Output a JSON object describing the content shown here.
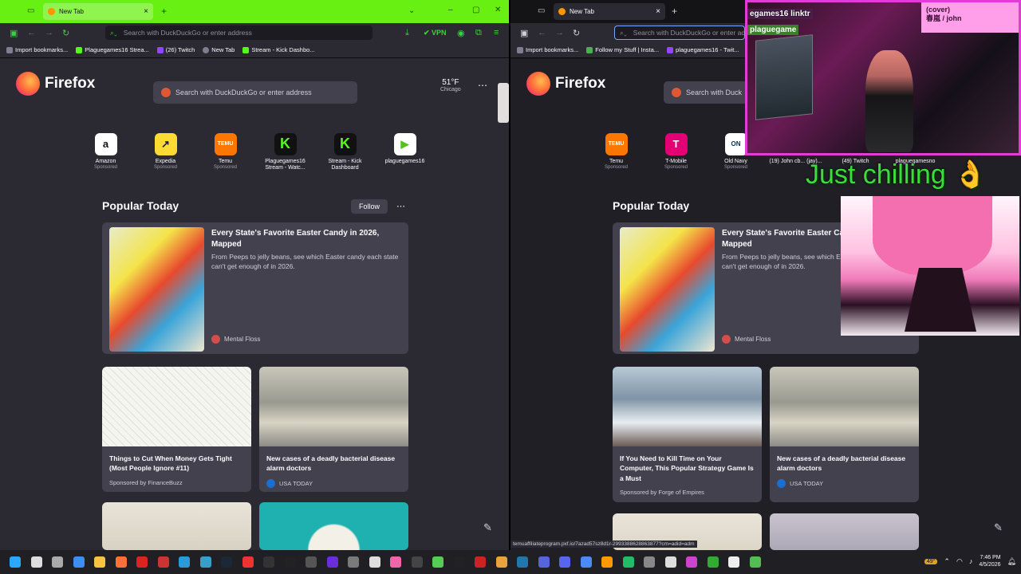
{
  "left_window": {
    "tab_title": "New Tab",
    "url_placeholder": "Search with DuckDuckGo or enter address",
    "vpn_label": "VPN",
    "bookmarks": [
      "Import bookmarks...",
      "Plaguegames16 Strea...",
      "(26) Twitch",
      "New Tab",
      "Stream - Kick Dashbo..."
    ],
    "brand": "Firefox",
    "search_placeholder": "Search with DuckDuckGo or enter address",
    "weather": {
      "temp": "51°F",
      "city": "Chicago"
    },
    "tiles": [
      {
        "name": "Amazon",
        "sub": "Sponsored",
        "icon": "amazon-icon",
        "glyph": "a"
      },
      {
        "name": "Expedia",
        "sub": "Sponsored",
        "icon": "expedia-icon",
        "glyph": "↗"
      },
      {
        "name": "Temu",
        "sub": "Sponsored",
        "icon": "temu-icon",
        "glyph": "TEMU"
      },
      {
        "name": "Plaguegames16 Stream - Watc...",
        "sub": "",
        "icon": "kick-icon",
        "glyph": "K"
      },
      {
        "name": "Stream - Kick Dashboard",
        "sub": "",
        "icon": "kick-icon",
        "glyph": "K"
      },
      {
        "name": "plaguegames16",
        "sub": "",
        "icon": "play-icon",
        "glyph": "▶"
      }
    ],
    "section_title": "Popular Today",
    "follow_label": "Follow",
    "featured": {
      "title": "Every State's Favorite Easter Candy in 2026, Mapped",
      "desc": "From Peeps to jelly beans, see which Easter candy each state can't get enough of in 2026.",
      "source": "Mental Floss"
    },
    "cards": [
      {
        "title": "Things to Cut When Money Gets Tight (Most People Ignore #11)",
        "source": "Sponsored by FinanceBuzz"
      },
      {
        "title": "New cases of a deadly bacterial disease alarm doctors",
        "source": "USA TODAY"
      }
    ]
  },
  "right_window": {
    "tab_title": "New Tab",
    "url_placeholder": "Search with DuckDuckGo or enter address",
    "bookmarks": [
      "Import bookmarks...",
      "Follow my Stuff | Insta...",
      "plaguegames16 - Twit..."
    ],
    "brand": "Firefox",
    "search_placeholder": "Search with Duck",
    "tiles": [
      {
        "name": "Temu",
        "sub": "Sponsored",
        "icon": "temu-icon",
        "glyph": "TEMU"
      },
      {
        "name": "T-Mobile",
        "sub": "Sponsored",
        "icon": "tmobile-icon",
        "glyph": "T"
      },
      {
        "name": "Old Navy",
        "sub": "Sponsored",
        "icon": "oldnavy-icon",
        "glyph": "ON"
      },
      {
        "name": "(19) John cb... (jay)...",
        "sub": "",
        "icon": "site-icon",
        "glyph": ""
      },
      {
        "name": "(49) Twitch",
        "sub": "",
        "icon": "twitch-icon",
        "glyph": ""
      },
      {
        "name": "plaguegamesno",
        "sub": "",
        "icon": "site-icon",
        "glyph": ""
      }
    ],
    "section_title": "Popular Today",
    "featured": {
      "title": "Every State's Favorite Easter Candy in 2026, Mapped",
      "desc": "From Peeps to jelly beans, see which Easter candy each state can't get enough of in 2026.",
      "source": "Mental Floss"
    },
    "cards": [
      {
        "title": "If You Need to Kill Time on Your Computer, This Popular Strategy Game Is a Must",
        "source": "Sponsored by Forge of Empires"
      },
      {
        "title": "New cases of a deadly bacterial disease alarm doctors",
        "source": "USA TODAY"
      }
    ],
    "status_url": "temuaffiliateprogram.pxf.io/7azad57sz8d1r-2993388628863877?cm=adid=adm"
  },
  "stream_overlay": {
    "cam_caption_1": "egames16 linktr",
    "cam_caption_2": "plaguegame",
    "cover_label": "(cover)",
    "cover_sub": "春嵐 / john",
    "chilling_text": "Just chilling",
    "chilling_emoji": "👌"
  },
  "taskbar": {
    "apps": [
      "start-icon",
      "search-icon",
      "taskview-icon",
      "edge-icon",
      "files-icon",
      "firefox-icon",
      "app-icon",
      "app-icon",
      "edge-icon",
      "app-icon",
      "steam-icon",
      "app-icon",
      "obs-icon",
      "app-icon",
      "app-icon",
      "app-icon",
      "app-icon",
      "app-icon",
      "app-icon",
      "app-icon",
      "app-icon",
      "app-icon",
      "app-icon",
      "app-icon",
      "app-icon",
      "app-icon",
      "discord-icon",
      "chrome-icon",
      "vlc-icon",
      "app-icon",
      "app-icon",
      "app-icon",
      "app-icon",
      "app-icon",
      "app-icon",
      "app-icon"
    ],
    "weather_badge": "49°",
    "time": "7:46 PM",
    "date": "4/5/2026"
  }
}
